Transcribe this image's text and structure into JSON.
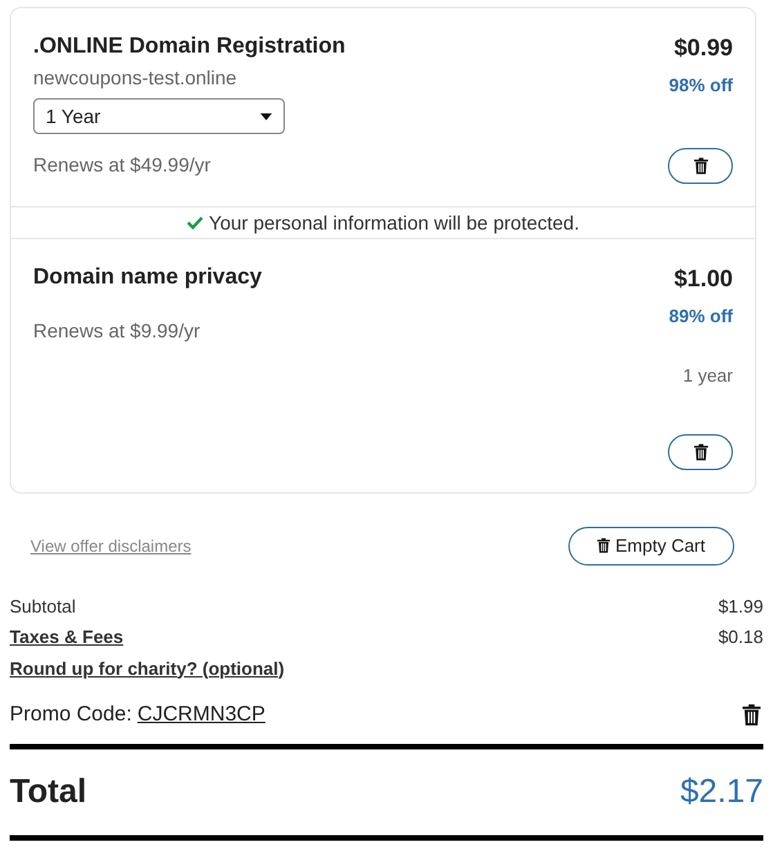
{
  "items": [
    {
      "name": ".ONLINE Domain Registration",
      "domain": "newcoupons-test.online",
      "term_select": "1 Year",
      "renews": "Renews at $49.99/yr",
      "price": "$0.99",
      "discount": "98% off"
    },
    {
      "name": "Domain name privacy",
      "renews": "Renews at $9.99/yr",
      "price": "$1.00",
      "discount": "89% off",
      "term": "1 year"
    }
  ],
  "privacy_notice": "Your personal information will be protected.",
  "disclaimers_link": "View offer disclaimers",
  "empty_cart_button": "Empty Cart",
  "summary": [
    {
      "label": "Subtotal",
      "value": "$1.99",
      "link": false
    },
    {
      "label": "Taxes & Fees",
      "value": "$0.18",
      "link": true
    },
    {
      "label": "Round up for charity? (optional)",
      "link": true
    }
  ],
  "promo": {
    "label": "Promo Code:",
    "code": "CJCRMN3CP"
  },
  "total": {
    "label": "Total",
    "value": "$2.17"
  }
}
